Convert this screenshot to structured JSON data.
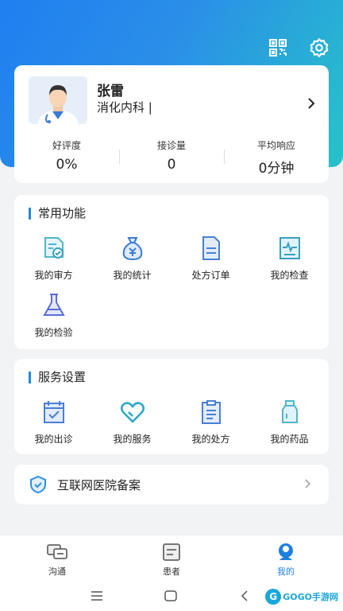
{
  "profile": {
    "name": "张雷",
    "department": "消化内科 |",
    "stats": [
      {
        "label": "好评度",
        "value": "0%"
      },
      {
        "label": "接诊量",
        "value": "0"
      },
      {
        "label": "平均响应",
        "value": "0分钟"
      }
    ]
  },
  "functions": {
    "title": "常用功能",
    "items": [
      {
        "label": "我的审方",
        "icon": "prescription-review-icon"
      },
      {
        "label": "我的统计",
        "icon": "money-bag-icon"
      },
      {
        "label": "处方订单",
        "icon": "document-icon"
      },
      {
        "label": "我的检查",
        "icon": "ecg-report-icon"
      },
      {
        "label": "我的检验",
        "icon": "flask-icon"
      }
    ]
  },
  "services": {
    "title": "服务设置",
    "items": [
      {
        "label": "我的出诊",
        "icon": "calendar-check-icon"
      },
      {
        "label": "我的服务",
        "icon": "heart-icon"
      },
      {
        "label": "我的处方",
        "icon": "clipboard-icon"
      },
      {
        "label": "我的药品",
        "icon": "medicine-bottle-icon"
      }
    ]
  },
  "record": {
    "label": "互联网医院备案"
  },
  "tabs": [
    {
      "label": "沟通"
    },
    {
      "label": "患者"
    },
    {
      "label": "我的"
    }
  ],
  "watermark": {
    "text": "GOGO手游网"
  },
  "colors": {
    "primary": "#1f7fe0",
    "accent_teal": "#27c3c8",
    "icon_blue": "#4a90d9"
  }
}
